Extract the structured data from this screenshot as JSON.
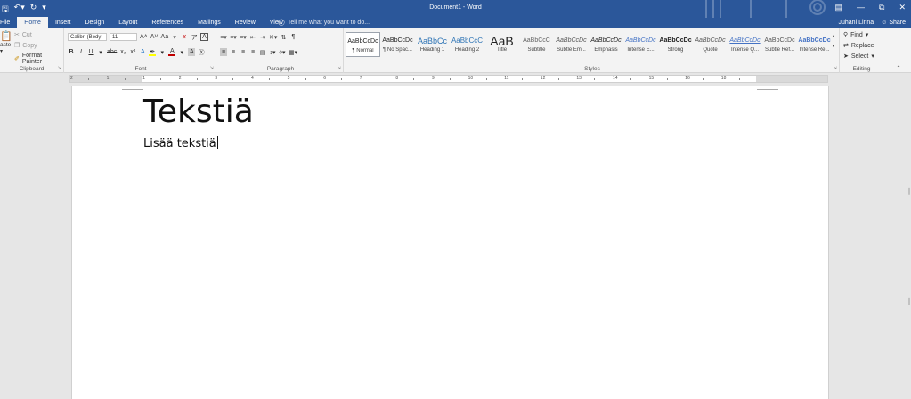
{
  "qat": {
    "save_icon": "save-icon",
    "undo_icon": "undo-icon",
    "redo_icon": "redo-icon",
    "customize_icon": "customize-qat-icon"
  },
  "window": {
    "title": "Document1 - Word"
  },
  "tabs": [
    "File",
    "Home",
    "Insert",
    "Design",
    "Layout",
    "References",
    "Mailings",
    "Review",
    "View"
  ],
  "tellme": {
    "placeholder": "Tell me what you want to do..."
  },
  "account": {
    "user": "Juhani Linna",
    "share": "Share"
  },
  "clipboard": {
    "paste": "aste",
    "cut": "Cut",
    "copy": "Copy",
    "format_painter": "Format Painter",
    "label": "Clipboard"
  },
  "font": {
    "name": "Calibri (Body",
    "size": "11",
    "label": "Font",
    "bold": "B",
    "italic": "I",
    "underline": "U",
    "strike": "abc",
    "subscript": "x₂",
    "superscript": "x²",
    "grow": "A˄",
    "shrink": "A˅",
    "case": "Aa",
    "text_effects": "A",
    "font_color": "A",
    "char_shade": "A"
  },
  "paragraph": {
    "label": "Paragraph"
  },
  "styles": {
    "label": "Styles",
    "items": [
      {
        "preview": "AaBbCcDc",
        "name": "¶ Normal"
      },
      {
        "preview": "AaBbCcDc",
        "name": "¶ No Spac..."
      },
      {
        "preview": "AaBbCc",
        "name": "Heading 1"
      },
      {
        "preview": "AaBbCcC",
        "name": "Heading 2"
      },
      {
        "preview": "AaB",
        "name": "Title"
      },
      {
        "preview": "AaBbCcC",
        "name": "Subtitle"
      },
      {
        "preview": "AaBbCcDc",
        "name": "Subtle Em..."
      },
      {
        "preview": "AaBbCcDc",
        "name": "Emphasis"
      },
      {
        "preview": "AaBbCcDc",
        "name": "Intense E..."
      },
      {
        "preview": "AaBbCcDc",
        "name": "Strong"
      },
      {
        "preview": "AaBbCcDc",
        "name": "Quote"
      },
      {
        "preview": "AaBbCcDc",
        "name": "Intense Q..."
      },
      {
        "preview": "AaBbCcDc",
        "name": "Subtle Ref..."
      },
      {
        "preview": "AaBbCcDc",
        "name": "Intense Re..."
      }
    ]
  },
  "editing": {
    "find": "Find",
    "replace": "Replace",
    "select": "Select",
    "label": "Editing"
  },
  "ruler": {
    "numbers": [
      "2",
      "1",
      "1",
      "2",
      "3",
      "4",
      "5",
      "6",
      "7",
      "8",
      "9",
      "10",
      "11",
      "12",
      "13",
      "14",
      "15",
      "16",
      "18"
    ]
  },
  "document": {
    "heading": "Tekstiä",
    "body": "Lisää tekstiä"
  },
  "colors": {
    "accent": "#2b579a",
    "highlight": "#ffff00",
    "font_color": "#c00000"
  }
}
